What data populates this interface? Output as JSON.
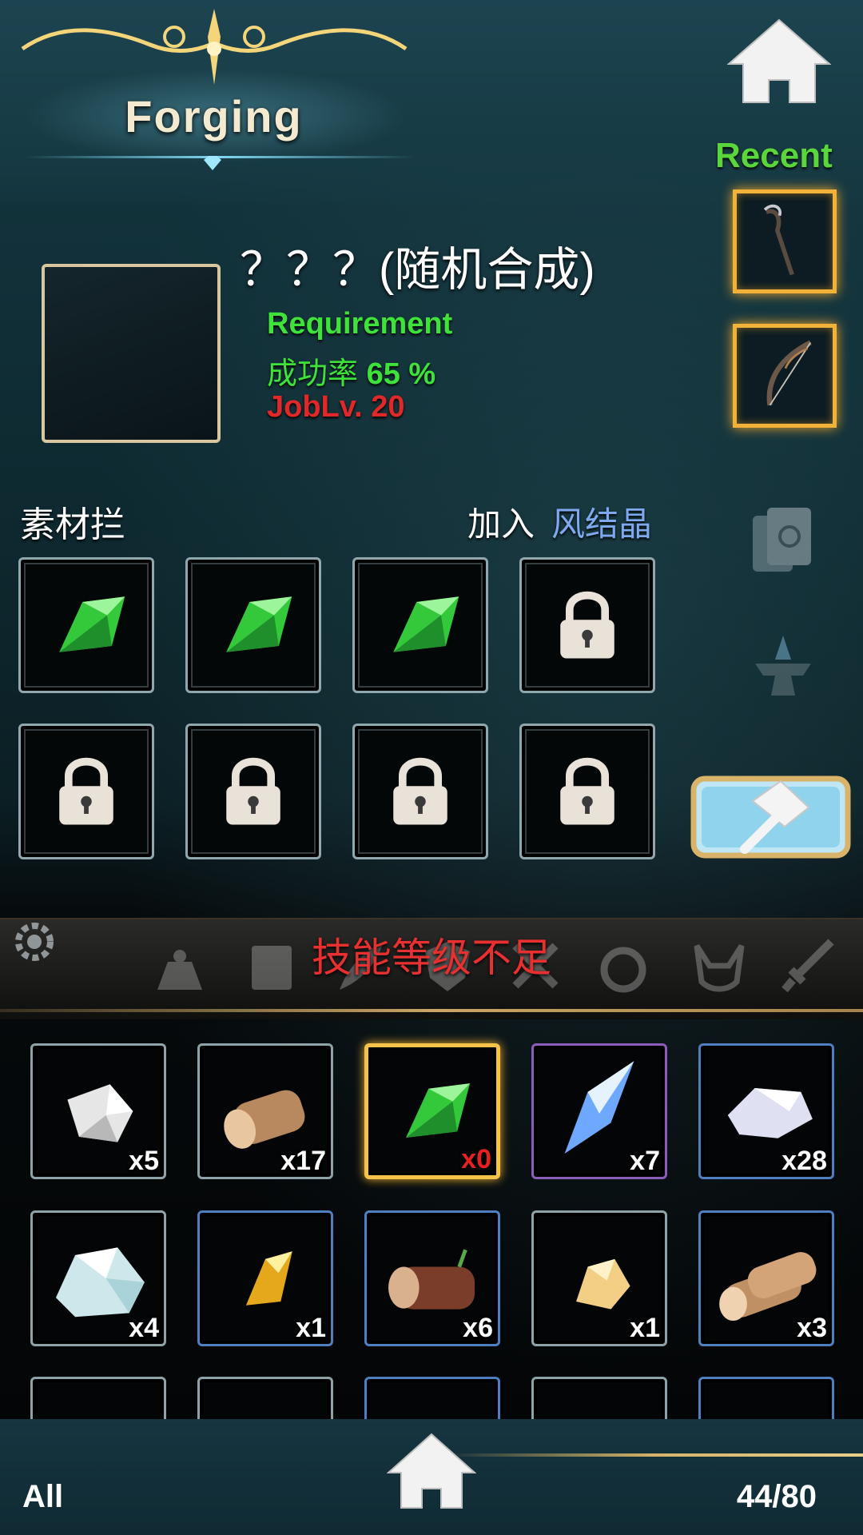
{
  "header": {
    "title": "Forging",
    "home_icon": "home-icon"
  },
  "recent": {
    "label": "Recent",
    "items": [
      {
        "icon": "staff-icon"
      },
      {
        "icon": "bow-icon"
      }
    ]
  },
  "recipe": {
    "name": "？？？(随机合成)",
    "requirement_label": "Requirement",
    "success_label": "成功率",
    "success_value": "65 %",
    "job_level": "JobLv. 20"
  },
  "materials": {
    "label": "素材拦",
    "add_label": "加入",
    "add_value": "风结晶",
    "slots": [
      {
        "icon": "green-crystal-icon",
        "locked": false
      },
      {
        "icon": "green-crystal-icon",
        "locked": false
      },
      {
        "icon": "green-crystal-icon",
        "locked": false
      },
      {
        "icon": "lock-icon",
        "locked": true
      },
      {
        "icon": "lock-icon",
        "locked": true
      },
      {
        "icon": "lock-icon",
        "locked": true
      },
      {
        "icon": "lock-icon",
        "locked": true
      },
      {
        "icon": "lock-icon",
        "locked": true
      }
    ]
  },
  "forge_button": {
    "icon": "hammer-icon"
  },
  "status": {
    "message": "技能等级不足",
    "categories": [
      "bag-icon",
      "book-icon",
      "feather-icon",
      "shield-icon",
      "cross-icon",
      "ring-icon",
      "headgear-icon",
      "sword-icon"
    ]
  },
  "inventory": {
    "items": [
      {
        "icon": "silver-ore-icon",
        "qty": "x5",
        "frame": "gray"
      },
      {
        "icon": "log-icon",
        "qty": "x17",
        "frame": "gray"
      },
      {
        "icon": "green-crystal-icon",
        "qty": "x0",
        "frame": "gold"
      },
      {
        "icon": "blue-crystal-icon",
        "qty": "x7",
        "frame": "purple"
      },
      {
        "icon": "white-stone-icon",
        "qty": "x28",
        "frame": "blue"
      },
      {
        "icon": "opal-rock-icon",
        "qty": "x4",
        "frame": "gray"
      },
      {
        "icon": "yellow-gem-icon",
        "qty": "x1",
        "frame": "blue"
      },
      {
        "icon": "dark-log-icon",
        "qty": "x6",
        "frame": "blue"
      },
      {
        "icon": "gold-nugget-icon",
        "qty": "x1",
        "frame": "gray"
      },
      {
        "icon": "wood-logs-icon",
        "qty": "x3",
        "frame": "blue"
      }
    ]
  },
  "footer": {
    "filter_label": "All",
    "capacity": "44/80"
  },
  "colors": {
    "accent_gold": "#f5c24a",
    "success_green": "#3ee23a",
    "error_red": "#e02828",
    "link_blue": "#7fa9ef"
  }
}
